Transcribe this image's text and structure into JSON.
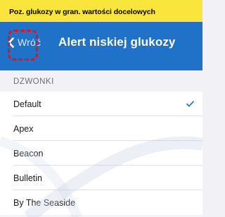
{
  "colors": {
    "banner_bg": "#f9e53c",
    "nav_bg": "#1f72c8",
    "accent": "#1d76d1",
    "callout": "#e0141b"
  },
  "banner": {
    "text": "Poz. glukozy w gran. wartości docelowych"
  },
  "nav": {
    "back_icon": "chevron-left-icon",
    "back_label": "Wróć",
    "title": "Alert niskiej glukozy"
  },
  "section": {
    "header": "DZWONKI"
  },
  "tones": [
    {
      "label": "Default",
      "selected": true
    },
    {
      "label": "Apex",
      "selected": false
    },
    {
      "label": "Beacon",
      "selected": false
    },
    {
      "label": "Bulletin",
      "selected": false
    },
    {
      "label": "By The Seaside",
      "selected": false
    }
  ],
  "selected_icon": "checkmark-icon"
}
